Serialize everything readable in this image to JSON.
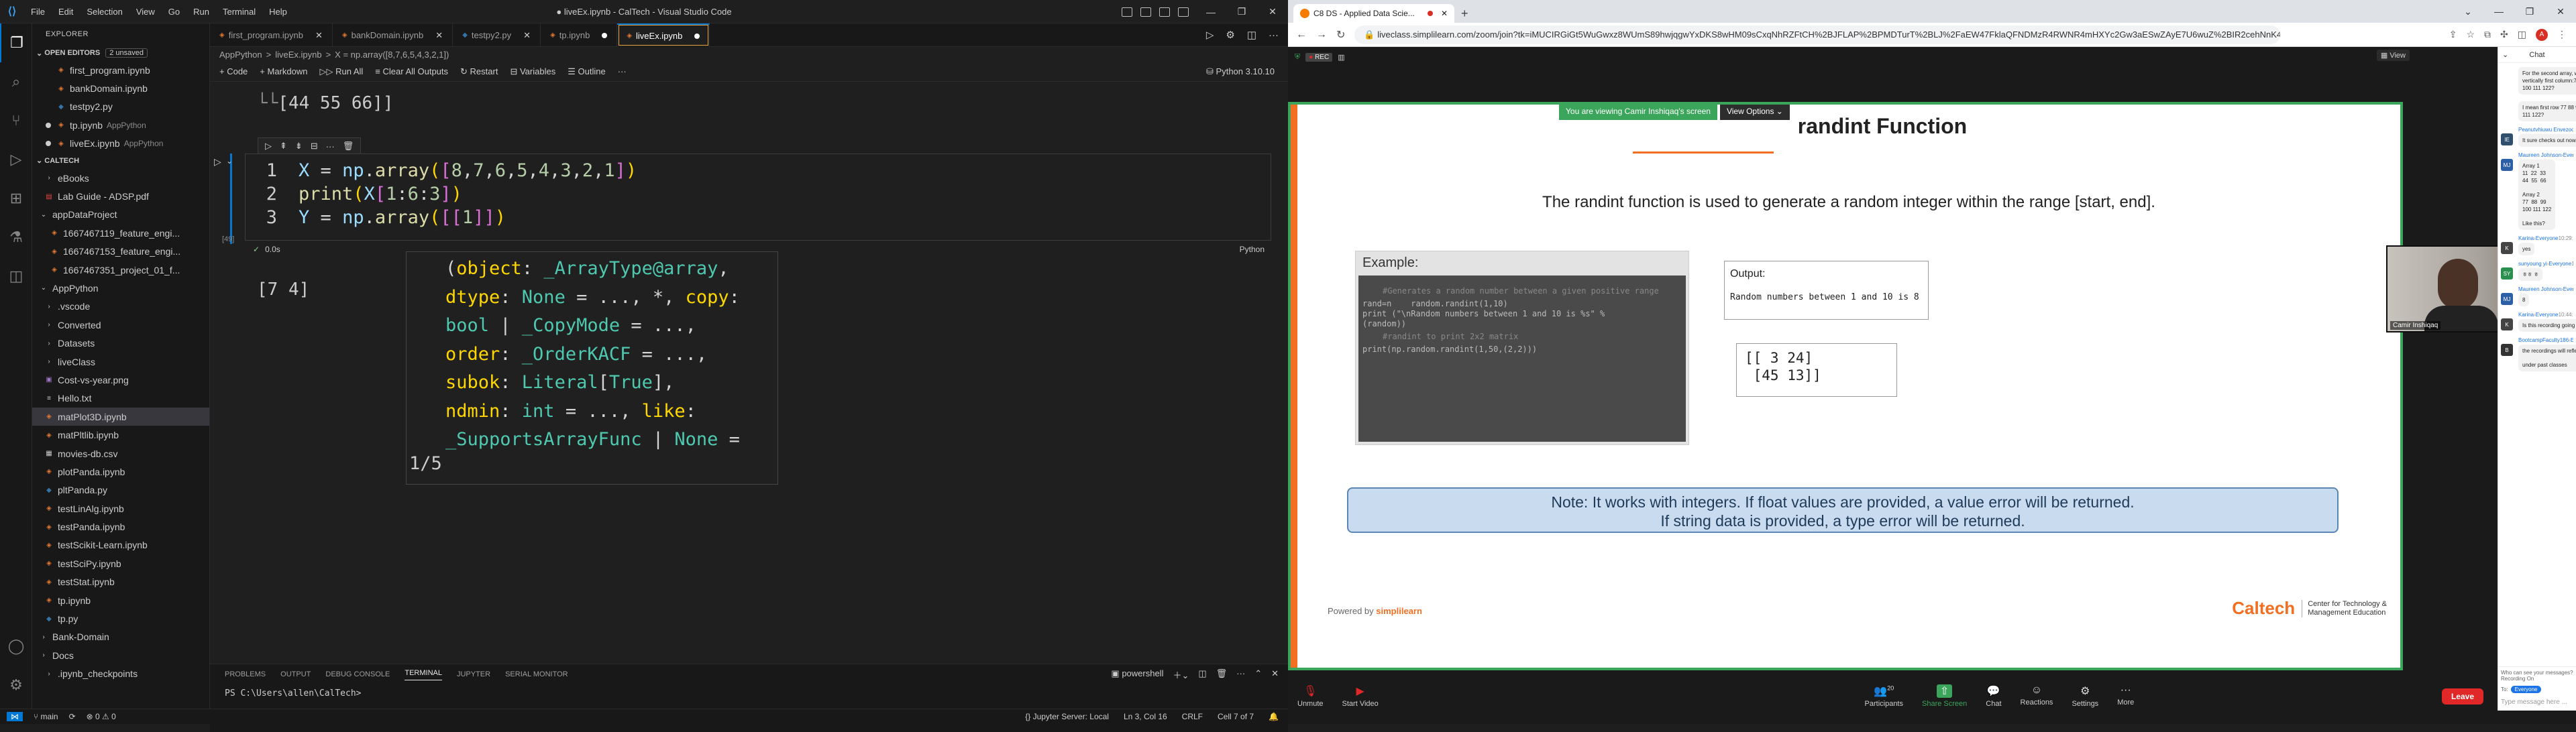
{
  "vscode": {
    "title": "● liveEx.ipynb - CalTech - Visual Studio Code",
    "menus": [
      "File",
      "Edit",
      "Selection",
      "View",
      "Go",
      "Run",
      "Terminal",
      "Help"
    ],
    "explorer_title": "EXPLORER",
    "open_editors_label": "OPEN EDITORS",
    "unsaved_badge": "2 unsaved",
    "open_editors": [
      {
        "name": "first_program.ipynb",
        "type": "nb",
        "desc": ""
      },
      {
        "name": "bankDomain.ipynb",
        "type": "nb",
        "desc": ""
      },
      {
        "name": "testpy2.py",
        "type": "py",
        "desc": ""
      },
      {
        "name": "tp.ipynb",
        "type": "nb",
        "desc": "AppPython",
        "modified": true
      },
      {
        "name": "liveEx.ipynb",
        "type": "nb",
        "desc": "AppPython",
        "modified": true
      }
    ],
    "workspace_label": "CALTECH",
    "tree": [
      {
        "name": "eBooks",
        "type": "folder",
        "indent": 1
      },
      {
        "name": "Lab Guide - ADSP.pdf",
        "type": "pdf",
        "indent": 1
      },
      {
        "name": "appDataProject",
        "type": "folder",
        "indent": 0,
        "open": true
      },
      {
        "name": "1667467119_feature_engi...",
        "type": "nb",
        "indent": 2
      },
      {
        "name": "1667467153_feature_engi...",
        "type": "nb",
        "indent": 2
      },
      {
        "name": "1667467351_project_01_f...",
        "type": "nb",
        "indent": 2
      },
      {
        "name": "AppPython",
        "type": "folder",
        "indent": 0,
        "open": true
      },
      {
        "name": ".vscode",
        "type": "folder",
        "indent": 1
      },
      {
        "name": "Converted",
        "type": "folder",
        "indent": 1
      },
      {
        "name": "Datasets",
        "type": "folder",
        "indent": 1
      },
      {
        "name": "liveClass",
        "type": "folder",
        "indent": 1
      },
      {
        "name": "Cost-vs-year.png",
        "type": "img",
        "indent": 1
      },
      {
        "name": "Hello.txt",
        "type": "txt",
        "indent": 1
      },
      {
        "name": "matPlot3D.ipynb",
        "type": "nb",
        "indent": 1,
        "selected": true
      },
      {
        "name": "matPltlib.ipynb",
        "type": "nb",
        "indent": 1
      },
      {
        "name": "movies-db.csv",
        "type": "csv",
        "indent": 1
      },
      {
        "name": "plotPanda.ipynb",
        "type": "nb",
        "indent": 1
      },
      {
        "name": "pltPanda.py",
        "type": "py",
        "indent": 1
      },
      {
        "name": "testLinAlg.ipynb",
        "type": "nb",
        "indent": 1
      },
      {
        "name": "testPanda.ipynb",
        "type": "nb",
        "indent": 1
      },
      {
        "name": "testScikit-Learn.ipynb",
        "type": "nb",
        "indent": 1
      },
      {
        "name": "testSciPy.ipynb",
        "type": "nb",
        "indent": 1
      },
      {
        "name": "testStat.ipynb",
        "type": "nb",
        "indent": 1
      },
      {
        "name": "tp.ipynb",
        "type": "nb",
        "indent": 1
      },
      {
        "name": "tp.py",
        "type": "py",
        "indent": 1
      },
      {
        "name": "Bank-Domain",
        "type": "folder",
        "indent": 0
      },
      {
        "name": "Docs",
        "type": "folder",
        "indent": 0
      },
      {
        "name": ".ipynb_checkpoints",
        "type": "folder",
        "indent": 1
      }
    ],
    "tabs": [
      {
        "name": "first_program.ipynb",
        "active": false
      },
      {
        "name": "bankDomain.ipynb",
        "active": false
      },
      {
        "name": "testpy2.py",
        "active": false,
        "py": true
      },
      {
        "name": "tp.ipynb",
        "active": false,
        "mod": true
      },
      {
        "name": "liveEx.ipynb",
        "active": true,
        "mod": true
      }
    ],
    "breadcrumb": [
      "AppPython",
      ">",
      "liveEx.ipynb",
      ">",
      "X = np.array([8,7,6,5,4,3,2,1])"
    ],
    "toolbar": {
      "code": "+ Code",
      "markdown": "+ Markdown",
      "run_all": "Run All",
      "clear": "Clear All Outputs",
      "restart": "Restart",
      "variables": "Variables",
      "outline": "Outline",
      "more": "···",
      "kernel": "Python 3.10.10"
    },
    "prev_output": "[44 55 66]]",
    "code_lines": [
      {
        "num": "1",
        "text": "X = np.array([8,7,6,5,4,3,2,1])"
      },
      {
        "num": "2",
        "text": "print(X[1:6:3])"
      },
      {
        "num": "3",
        "text": "Y = np.array([[1]])"
      }
    ],
    "exec_count": "[49]",
    "cell_time": "0.0s",
    "cell_lang": "Python",
    "output": "[7 4]",
    "hover_lines": [
      "(object: _ArrayType@array,",
      "dtype: None = ..., *, copy:",
      "bool | _CopyMode = ...,",
      "order: _OrderKACF = ...,",
      "subok: Literal[True],",
      "ndmin: int = ..., like:",
      "_SupportsArrayFunc | None ="
    ],
    "hover_counter": "1/5",
    "panel_tabs": [
      "PROBLEMS",
      "OUTPUT",
      "DEBUG CONSOLE",
      "TERMINAL",
      "JUPYTER",
      "SERIAL MONITOR"
    ],
    "panel_active": "TERMINAL",
    "terminal_shell": "powershell",
    "terminal_line": "PS C:\\Users\\allen\\CalTech>",
    "status": {
      "branch": "main",
      "errors": "⊗ 0 ⚠ 0",
      "jupyter": "{} Jupyter Server: Local",
      "position": "Ln 3, Col 16",
      "eol": "CRLF",
      "cell": "Cell 7 of 7"
    }
  },
  "browser": {
    "tab_title": "C8 DS - Applied Data Scie...",
    "url": "liveclass.simplilearn.com/zoom/join?tk=iMUCIRGiGt5WuGwxz8WUmS89hwjqgwYxDKS8wHM09sCxqNhRZFtCH%2BJFLAP%2BPMDTurT%2BLJ%2FaEW47FklaQFNDMzR4RWNR4mHXYc2Gw3aESwZAyE7U6wuZ%2BIR2cehNnK4pN7rucDNriSpoiSOyl6..."
  },
  "zoom": {
    "rec": "REC",
    "view_btn": "View",
    "viewing_banner": "You are viewing Camir Inshiqaq's screen",
    "view_options": "View Options",
    "slide": {
      "title": "randint Function",
      "desc": "The randint function is used to generate a random integer within the range [start, end].",
      "example_label": "Example:",
      "example_code": [
        {
          "t": "#Generates a random number between a given positive range",
          "c": true
        },
        {
          "t": "rand=n    random.randint(1,10)",
          "c": false
        },
        {
          "t": "print (\"\\nRandom numbers between 1 and 10 is %s\" %",
          "c": false
        },
        {
          "t": "(random))",
          "c": false
        },
        {
          "t": "",
          "c": false
        },
        {
          "t": "#randint to print 2x2 matrix",
          "c": true
        },
        {
          "t": "print(np.random.randint(1,50,(2,2)))",
          "c": false
        }
      ],
      "output_label": "Output:",
      "output_value": "Random numbers between 1 and 10 is 8",
      "matrix": "[[ 3 24]\n [45 13]]",
      "note_line1": "Note: It works with integers. If float values are provided, a value error will be returned.",
      "note_line2": "If string data is provided, a type error will be returned.",
      "powered": "Powered by",
      "powered_brand": "simplilearn",
      "caltech_name": "Caltech",
      "caltech_sub1": "Center for Technology &",
      "caltech_sub2": "Management Education"
    },
    "video_name": "Camir Inshiqaq",
    "bottom": {
      "unmute": "Unmute",
      "start_video": "Start Video",
      "participants": "Participants",
      "participants_count": "20",
      "share": "Share Screen",
      "chat": "Chat",
      "reactions": "Reactions",
      "settings": "Settings",
      "more": "More",
      "leave": "Leave"
    },
    "chat": {
      "title": "Chat",
      "messages": [
        {
          "sender": "",
          "to": "",
          "time": "",
          "lines": [
            "For the second array, would these be listed",
            "vertically first column:77 88 99  second column:",
            "100 111 122?"
          ],
          "avatar": "",
          "color": ""
        },
        {
          "sender": "",
          "to": "",
          "time": "",
          "lines": [
            "I mean first row 77 88 99 and second row 100",
            "111 122?"
          ],
          "avatar": "",
          "color": ""
        },
        {
          "sender": "Peanutvhiuwu Envezoo",
          "to": "Everyone",
          "time": "10:27:36 AM",
          "lines": [
            "It sure checks out now. Thanks. Understood"
          ],
          "avatar": "IE",
          "color": "#2f4f6f"
        },
        {
          "sender": "Maureen Johnson",
          "to": "Everyone",
          "time": "10:28:50 AM",
          "lines": [
            "Array 1",
            "11  22  33",
            "44  55  66",
            "",
            "Array 2",
            "77  88  99",
            "100 111 122",
            "",
            "Like this?"
          ],
          "avatar": "MJ",
          "color": "#2d5fa6"
        },
        {
          "sender": "Karina",
          "to": "Everyone",
          "time": "10:29:34 AM",
          "lines": [
            "yes"
          ],
          "avatar": "K",
          "color": "#444"
        },
        {
          "sender": "sunyoung yi",
          "to": "Everyone",
          "time": "10:29:41 AM",
          "lines": [
            "ㅎㅎ ㅎ"
          ],
          "avatar": "SY",
          "color": "#2a8f4f"
        },
        {
          "sender": "Maureen Johnson",
          "to": "Everyone",
          "time": "10:31:24 AM",
          "lines": [
            "8"
          ],
          "avatar": "MJ",
          "color": "#2d5fa6"
        },
        {
          "sender": "Karina",
          "to": "Everyone",
          "time": "10:44:48 AM",
          "lines": [
            "Is this recording going to be available today?"
          ],
          "avatar": "K",
          "color": "#444"
        },
        {
          "sender": "BootcampFaculty186",
          "to": "Everyone",
          "time": "10:47:09 AM",
          "lines": [
            "the recordings will reflect after 24hrs",
            "",
            "under past classes"
          ],
          "avatar": "B",
          "color": "#333"
        }
      ],
      "who_can_see": "Who can see your messages? Recording On",
      "to_label": "To:",
      "to_value": "Everyone",
      "placeholder": "Type message here ..."
    }
  }
}
